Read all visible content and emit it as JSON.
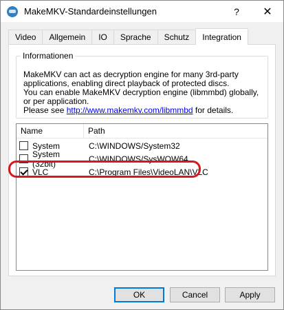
{
  "window": {
    "title": "MakeMKV-Standardeinstellungen",
    "help_glyph": "?",
    "close_glyph": "✕"
  },
  "tabs": [
    {
      "label": "Video"
    },
    {
      "label": "Allgemein"
    },
    {
      "label": "IO"
    },
    {
      "label": "Sprache"
    },
    {
      "label": "Schutz"
    },
    {
      "label": "Integration"
    }
  ],
  "active_tab": "Integration",
  "info": {
    "group_title": "Informationen",
    "line1": "MakeMKV can act as decryption engine for many 3rd-party applications, enabling direct playback of protected discs.",
    "line2": "You can enable MakeMKV decryption engine (libmmbd) globally, or per application.",
    "line3_prefix": "Please see ",
    "link_text": "http://www.makemkv.com/libmmbd",
    "line3_suffix": " for details."
  },
  "list": {
    "columns": {
      "name": "Name",
      "path": "Path"
    },
    "rows": [
      {
        "name": "System",
        "path": "C:\\WINDOWS/System32",
        "checked": false
      },
      {
        "name": "System (32bit)",
        "path": "C:\\WINDOWS/SysWOW64",
        "checked": false
      },
      {
        "name": "VLC",
        "path": "C:\\Program Files\\VideoLAN\\VLC",
        "checked": true
      }
    ]
  },
  "buttons": {
    "ok": "OK",
    "cancel": "Cancel",
    "apply": "Apply"
  },
  "colors": {
    "highlight": "#d9161c",
    "link": "#0000ee"
  }
}
